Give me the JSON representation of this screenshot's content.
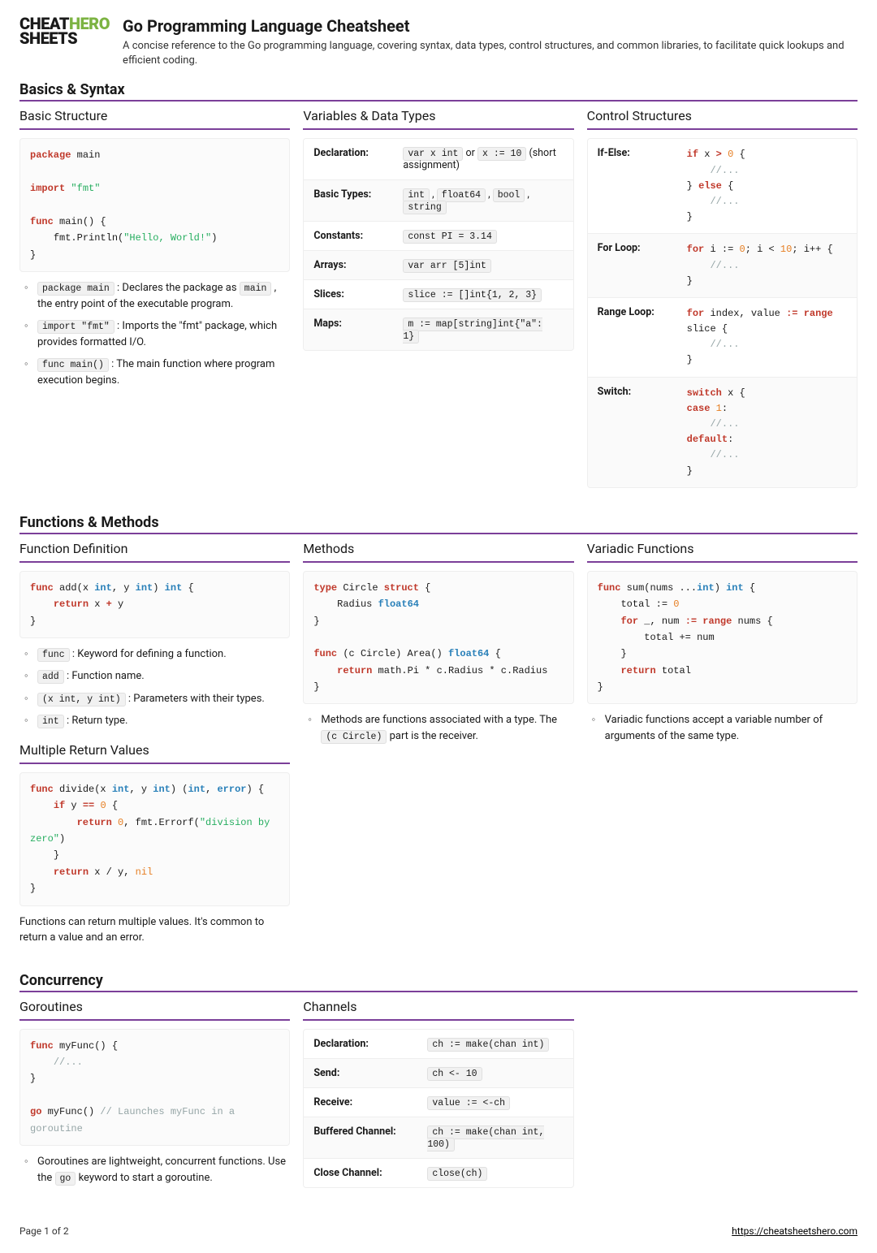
{
  "logo": {
    "line1": "CHEAT",
    "line2": "SHEETS",
    "hero": "HERO"
  },
  "title": "Go Programming Language Cheatsheet",
  "subtitle": "A concise reference to the Go programming language, covering syntax, data types, control structures, and common libraries, to facilitate quick lookups and efficient coding.",
  "sections": {
    "basics": {
      "heading": "Basics & Syntax",
      "basic_structure": {
        "title": "Basic Structure",
        "notes": [
          {
            "code": "package main",
            "text": " : Declares the package as ",
            "code2": "main",
            "text2": " , the entry point of the executable program."
          },
          {
            "code": "import \"fmt\"",
            "text": " : Imports the \"fmt\" package, which provides formatted I/O."
          },
          {
            "code": "func main()",
            "text": " : The main function where program execution begins."
          }
        ]
      },
      "variables": {
        "title": "Variables & Data Types",
        "rows": [
          {
            "k": "Declaration:",
            "codes": [
              "var x int"
            ],
            "mid": " or ",
            "codes2": [
              "x := 10"
            ],
            "tail": " (short assignment)"
          },
          {
            "k": "Basic Types:",
            "codes": [
              "int",
              "float64",
              "bool",
              "string"
            ]
          },
          {
            "k": "Constants:",
            "codes": [
              "const PI = 3.14"
            ]
          },
          {
            "k": "Arrays:",
            "codes": [
              "var arr [5]int"
            ]
          },
          {
            "k": "Slices:",
            "codes": [
              "slice := []int{1, 2, 3}"
            ]
          },
          {
            "k": "Maps:",
            "codes": [
              "m := map[string]int{\"a\": 1}"
            ]
          }
        ]
      },
      "control": {
        "title": "Control Structures",
        "rows": [
          {
            "k": "If-Else:"
          },
          {
            "k": "For Loop:"
          },
          {
            "k": "Range Loop:"
          },
          {
            "k": "Switch:"
          }
        ]
      }
    },
    "functions": {
      "heading": "Functions & Methods",
      "defn": {
        "title": "Function Definition",
        "notes": [
          {
            "code": "func",
            "text": " : Keyword for defining a function."
          },
          {
            "code": "add",
            "text": " : Function name."
          },
          {
            "code": "(x int, y int)",
            "text": " : Parameters with their types."
          },
          {
            "code": "int",
            "text": " : Return type."
          }
        ]
      },
      "multret": {
        "title": "Multiple Return Values",
        "para": "Functions can return multiple values. It's common to return a value and an error."
      },
      "methods": {
        "title": "Methods",
        "note_pre": "Methods are functions associated with a type. The ",
        "note_code": "(c Circle)",
        "note_post": " part is the receiver."
      },
      "variadic": {
        "title": "Variadic Functions",
        "note": "Variadic functions accept a variable number of arguments of the same type."
      }
    },
    "concurrency": {
      "heading": "Concurrency",
      "goroutines": {
        "title": "Goroutines",
        "note_pre": "Goroutines are lightweight, concurrent functions. Use the ",
        "note_code": "go",
        "note_post": " keyword to start a goroutine."
      },
      "channels": {
        "title": "Channels",
        "rows": [
          {
            "k": "Declaration:",
            "v": "ch := make(chan int)"
          },
          {
            "k": "Send:",
            "v": "ch <- 10"
          },
          {
            "k": "Receive:",
            "v": "value := <-ch"
          },
          {
            "k": "Buffered Channel:",
            "v": "ch := make(chan int, 100)"
          },
          {
            "k": "Close Channel:",
            "v": "close(ch)"
          }
        ]
      }
    }
  },
  "footer": {
    "page": "Page 1 of 2",
    "url": "https://cheatsheetshero.com"
  }
}
